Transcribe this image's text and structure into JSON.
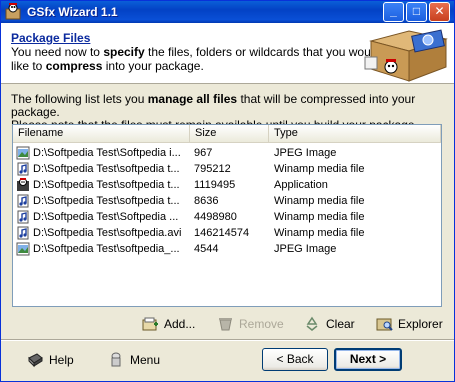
{
  "titlebar": {
    "title": "GSfx Wizard 1.1"
  },
  "header": {
    "title": "Package Files",
    "desc_1": "You need now to ",
    "desc_specify": "specify",
    "desc_2": " the files, folders or wildcards that you would like to ",
    "desc_compress": "compress",
    "desc_3": " into your package."
  },
  "intro": {
    "line1a": "The following list lets you ",
    "line1b": "manage all files",
    "line1c": " that will be compressed into your package.",
    "line2": "Please note that the files must remain available until you build your package."
  },
  "list": {
    "columns": {
      "filename": "Filename",
      "size": "Size",
      "type": "Type"
    },
    "rows": [
      {
        "name": "D:\\Softpedia Test\\Softpedia i...",
        "size": "967",
        "type": "JPEG Image",
        "icon": "image-file-icon"
      },
      {
        "name": "D:\\Softpedia Test\\softpedia t...",
        "size": "795212",
        "type": "Winamp media file",
        "icon": "media-file-icon"
      },
      {
        "name": "D:\\Softpedia Test\\softpedia t...",
        "size": "1119495",
        "type": "Application",
        "icon": "application-file-icon"
      },
      {
        "name": "D:\\Softpedia Test\\softpedia t...",
        "size": "8636",
        "type": "Winamp media file",
        "icon": "media-file-icon"
      },
      {
        "name": "D:\\Softpedia Test\\Softpedia ...",
        "size": "4498980",
        "type": "Winamp media file",
        "icon": "media-file-icon"
      },
      {
        "name": "D:\\Softpedia Test\\softpedia.avi",
        "size": "146214574",
        "type": "Winamp media file",
        "icon": "media-file-icon"
      },
      {
        "name": "D:\\Softpedia Test\\softpedia_...",
        "size": "4544",
        "type": "JPEG Image",
        "icon": "image-file-icon"
      }
    ]
  },
  "actions": {
    "add": "Add...",
    "remove": "Remove",
    "clear": "Clear",
    "explorer": "Explorer"
  },
  "footer": {
    "help": "Help",
    "menu": "Menu",
    "back": "< Back",
    "next": "Next >"
  }
}
